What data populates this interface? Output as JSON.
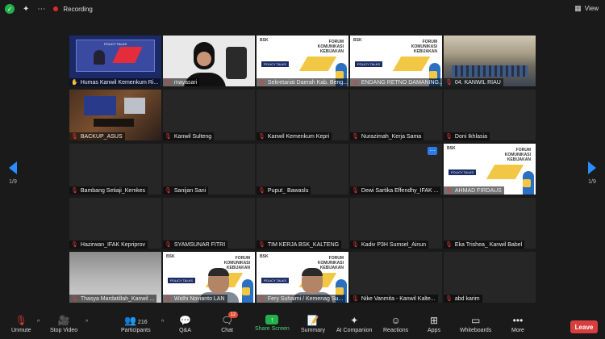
{
  "topbar": {
    "recording_label": "Recording",
    "view_label": "View"
  },
  "pagination": {
    "left": "1/9",
    "right": "1/9"
  },
  "tiles": [
    {
      "name": "Humas Kanwil Kemenkum Ri...",
      "kind": "stage",
      "active": true,
      "pinned": true,
      "muted": false
    },
    {
      "name": "mayasari",
      "kind": "face",
      "muted": true
    },
    {
      "name": "Sekretariat Daerah Kab. Beng...",
      "kind": "slide",
      "muted": true
    },
    {
      "name": "ENDANG RETNO DAMANING...",
      "kind": "slide",
      "muted": true
    },
    {
      "name": "04. KANWIL RIAU",
      "kind": "hall",
      "muted": true
    },
    {
      "name": "BACKUP_ASUS",
      "kind": "studio",
      "muted": true
    },
    {
      "name": "Kanwil Sulteng",
      "kind": "blank",
      "muted": true
    },
    {
      "name": "Kanwil Kemenkum Kepri",
      "kind": "blank",
      "muted": true
    },
    {
      "name": "Nurazimah_Kerja Sama",
      "kind": "blank",
      "muted": true
    },
    {
      "name": "Doni Ikhlasia",
      "kind": "blank",
      "muted": true
    },
    {
      "name": "Bambang Setiaji_Kemkes",
      "kind": "blank",
      "muted": true
    },
    {
      "name": "Sanijan Sani",
      "kind": "blank",
      "muted": true
    },
    {
      "name": "Puput_ Bawaslu",
      "kind": "blank",
      "muted": true
    },
    {
      "name": "Dewi Sartika Effendhy_IFAK ...",
      "kind": "blank",
      "muted": true,
      "more": true
    },
    {
      "name": "AHMAD FIRDAUS",
      "kind": "slide",
      "muted": true
    },
    {
      "name": "Hazirwan_IFAK Kepriprov",
      "kind": "blank",
      "muted": true
    },
    {
      "name": "SYAMSUNAR FITRI",
      "kind": "blank",
      "muted": true
    },
    {
      "name": "TIM KERJA BSK_KALTENG",
      "kind": "blank",
      "muted": true
    },
    {
      "name": "Kadiv P3H Sumsel_Ainun",
      "kind": "blank",
      "muted": true
    },
    {
      "name": "Eka Trishea_ Kanwil Babel",
      "kind": "blank",
      "muted": true
    },
    {
      "name": "Thasya Mardatillah_Kanwil ...",
      "kind": "blur",
      "muted": true
    },
    {
      "name": "Widhi Novianto LAN",
      "kind": "slideface",
      "muted": true
    },
    {
      "name": "Fery Suhaimi / Kemenag Su...",
      "kind": "slideface",
      "muted": true
    },
    {
      "name": "Nike Vanmita - Kanwil Kalte...",
      "kind": "blank",
      "muted": true
    },
    {
      "name": "abd karim",
      "kind": "blank",
      "muted": true
    }
  ],
  "slide_text": {
    "logo": "BSK",
    "title_l1": "FORUM",
    "title_l2": "KOMUNIKASI",
    "title_l3": "KEBIJAKAN",
    "policy": "POLICY TALKS"
  },
  "toolbar": {
    "unmute": "Unmute",
    "stop_video": "Stop Video",
    "participants": "Participants",
    "participants_count": "216",
    "qa": "Q&A",
    "chat": "Chat",
    "chat_badge": "12",
    "share": "Share Screen",
    "summary": "Summary",
    "ai": "AI Companion",
    "reactions": "Reactions",
    "apps": "Apps",
    "whiteboards": "Whiteboards",
    "more": "More",
    "leave": "Leave"
  },
  "colors": {
    "accent": "#2a8cff",
    "share_green": "#23b14d",
    "leave_red": "#d93e3e",
    "active_border": "#8fd14f"
  }
}
